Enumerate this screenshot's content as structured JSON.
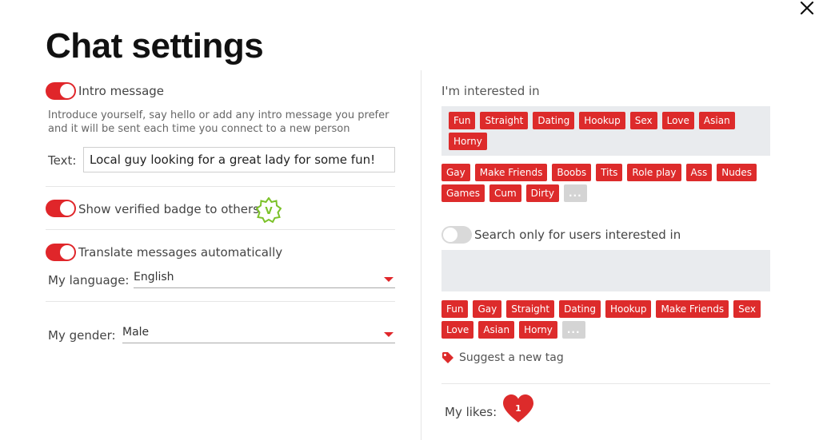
{
  "title": "Chat settings",
  "intro": {
    "label": "Intro message",
    "description_line1": "Introduce yourself, say hello or add any intro message you prefer",
    "description_line2": "and it will be sent each time you connect to a new person",
    "text_label": "Text:",
    "text_value": "Local guy looking for a great lady for some fun!"
  },
  "verified": {
    "label": "Show verified badge to others",
    "badge_letter": "V"
  },
  "translate": {
    "label": "Translate messages automatically",
    "language_label": "My language:",
    "language_value": "English"
  },
  "gender": {
    "label": "My gender:",
    "value": "Male"
  },
  "interested": {
    "label": "I'm interested in",
    "selected": [
      "Fun",
      "Straight",
      "Dating",
      "Hookup",
      "Sex",
      "Love",
      "Asian",
      "Horny"
    ],
    "suggested": [
      "Gay",
      "Make Friends",
      "Boobs",
      "Tits",
      "Role play",
      "Ass",
      "Nudes",
      "Games",
      "Cum",
      "Dirty",
      "..."
    ]
  },
  "search_only": {
    "label": "Search only for users interested in",
    "suggested": [
      "Fun",
      "Gay",
      "Straight",
      "Dating",
      "Hookup",
      "Make Friends",
      "Sex",
      "Love",
      "Asian",
      "Horny",
      "..."
    ]
  },
  "suggest_tag": "Suggest a new tag",
  "likes": {
    "label": "My likes:",
    "count": "1"
  },
  "colors": {
    "accent": "#dd2b2b",
    "toggle_on": "#e0262a",
    "toggle_off": "#d9d9d9",
    "tagbox": "#e9ebee",
    "badge": "#7cc22a"
  },
  "icons": [
    "close-icon",
    "verified-badge-icon",
    "tag-icon",
    "heart-icon",
    "caret-down-icon"
  ]
}
